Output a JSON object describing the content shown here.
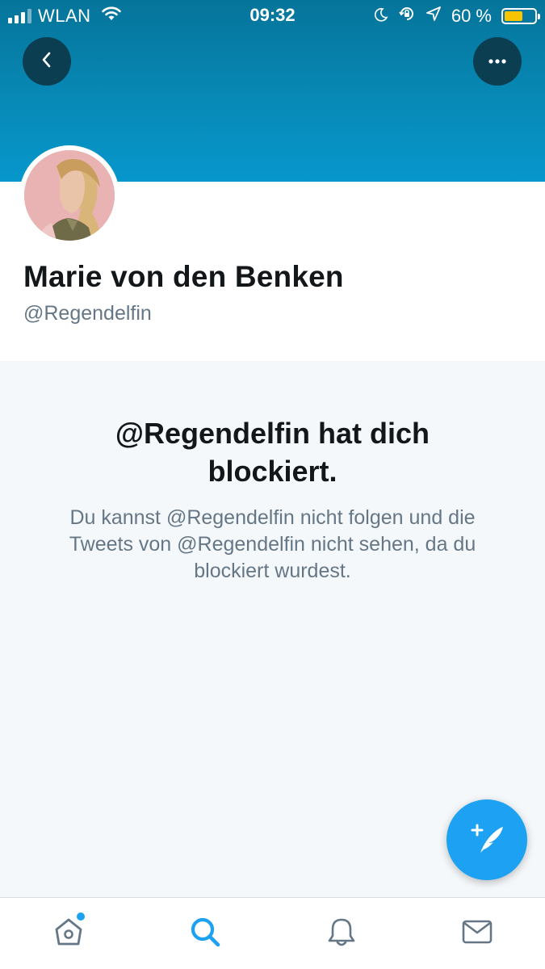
{
  "status_bar": {
    "carrier": "WLAN",
    "time": "09:32",
    "battery_percent": "60 %",
    "battery_level": 0.6
  },
  "header": {
    "back_icon": "chevron-left-icon",
    "more_icon": "more-horizontal-icon",
    "banner_color": "#0789b6",
    "button_color": "#0c3e52"
  },
  "profile": {
    "name": "Marie von den Benken",
    "handle": "@Regendelfin"
  },
  "blocked": {
    "title": "@Regendelfin hat dich blockiert.",
    "message": "Du kannst @Regendelfin nicht folgen und die Tweets von @Regendelfin nicht sehen, da du blockiert wurdest."
  },
  "compose": {
    "icon": "compose-tweet-icon",
    "color": "#1da1f2"
  },
  "tab_bar": {
    "tabs": [
      {
        "name": "home",
        "icon": "home-icon",
        "has_badge": true
      },
      {
        "name": "search",
        "icon": "search-icon",
        "active": true
      },
      {
        "name": "notifications",
        "icon": "bell-icon"
      },
      {
        "name": "messages",
        "icon": "mail-icon"
      }
    ],
    "active_color": "#1da1f2",
    "inactive_color": "#657786"
  }
}
